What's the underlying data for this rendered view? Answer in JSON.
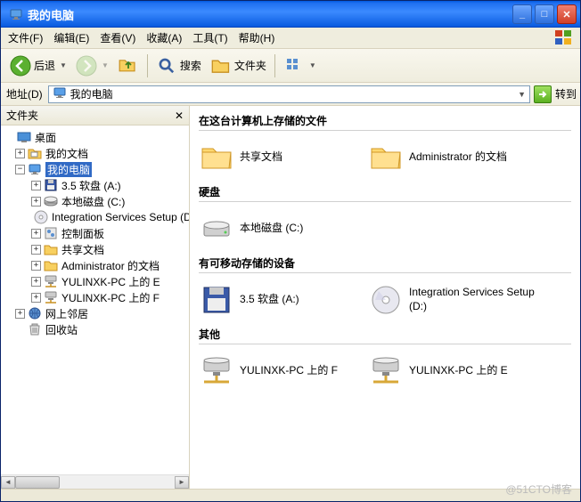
{
  "window": {
    "title": "我的电脑"
  },
  "menu": {
    "file": "文件(F)",
    "edit": "编辑(E)",
    "view": "查看(V)",
    "favorites": "收藏(A)",
    "tools": "工具(T)",
    "help": "帮助(H)"
  },
  "toolbar": {
    "back": "后退",
    "search": "搜索",
    "folders": "文件夹"
  },
  "address": {
    "label": "地址(D)",
    "value": "我的电脑",
    "go": "转到"
  },
  "sidebar": {
    "title": "文件夹"
  },
  "tree": {
    "desktop": "桌面",
    "mydocs": "我的文档",
    "mycomputer": "我的电脑",
    "floppy": "3.5 软盘 (A:)",
    "localc": "本地磁盘 (C:)",
    "intsvc": "Integration Services Setup (D:)",
    "cpanel": "控制面板",
    "shared": "共享文档",
    "admin": "Administrator 的文档",
    "nete": "YULINXK-PC 上的 E",
    "netf": "YULINXK-PC 上的 F",
    "network": "网上邻居",
    "recycle": "回收站"
  },
  "sections": {
    "files": "在这台计算机上存储的文件",
    "hdd": "硬盘",
    "removable": "有可移动存储的设备",
    "other": "其他"
  },
  "items": {
    "shared": "共享文档",
    "admin": "Administrator 的文档",
    "localc": "本地磁盘 (C:)",
    "floppy": "3.5 软盘 (A:)",
    "intsvc": "Integration Services Setup (D:)",
    "netf": "YULINXK-PC 上的 F",
    "nete": "YULINXK-PC 上的 E"
  },
  "watermark": "@51CTO博客"
}
